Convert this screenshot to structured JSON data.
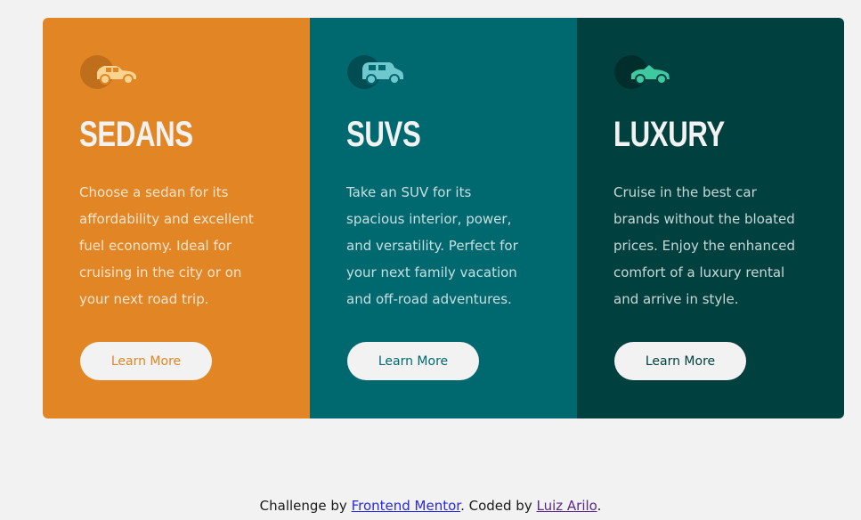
{
  "cards": [
    {
      "icon": "sedan-car-icon",
      "title": "SEDANS",
      "description": "Choose a sedan for its affordability and excellent fuel economy. Ideal for cruising in the city or on your next road trip.",
      "button_label": "Learn More",
      "color": "#e28625"
    },
    {
      "icon": "suv-car-icon",
      "title": "SUVS",
      "description": "Take an SUV for its spacious interior, power, and versatility. Perfect for your next family vacation and off-road adventures.",
      "button_label": "Learn More",
      "color": "#006970"
    },
    {
      "icon": "luxury-car-icon",
      "title": "LUXURY",
      "description": "Cruise in the best car brands without the bloated prices. Enjoy the enhanced comfort of a luxury rental and arrive in style.",
      "button_label": "Learn More",
      "color": "#004140"
    }
  ],
  "footer": {
    "prefix": "Challenge by ",
    "challenge_link": "Frontend Mentor",
    "middle": ". Coded by ",
    "author_link": "Luiz Arilo",
    "suffix": "."
  },
  "colors": {
    "background": "#f2f2f2",
    "button_bg": "#f2f2f2"
  }
}
